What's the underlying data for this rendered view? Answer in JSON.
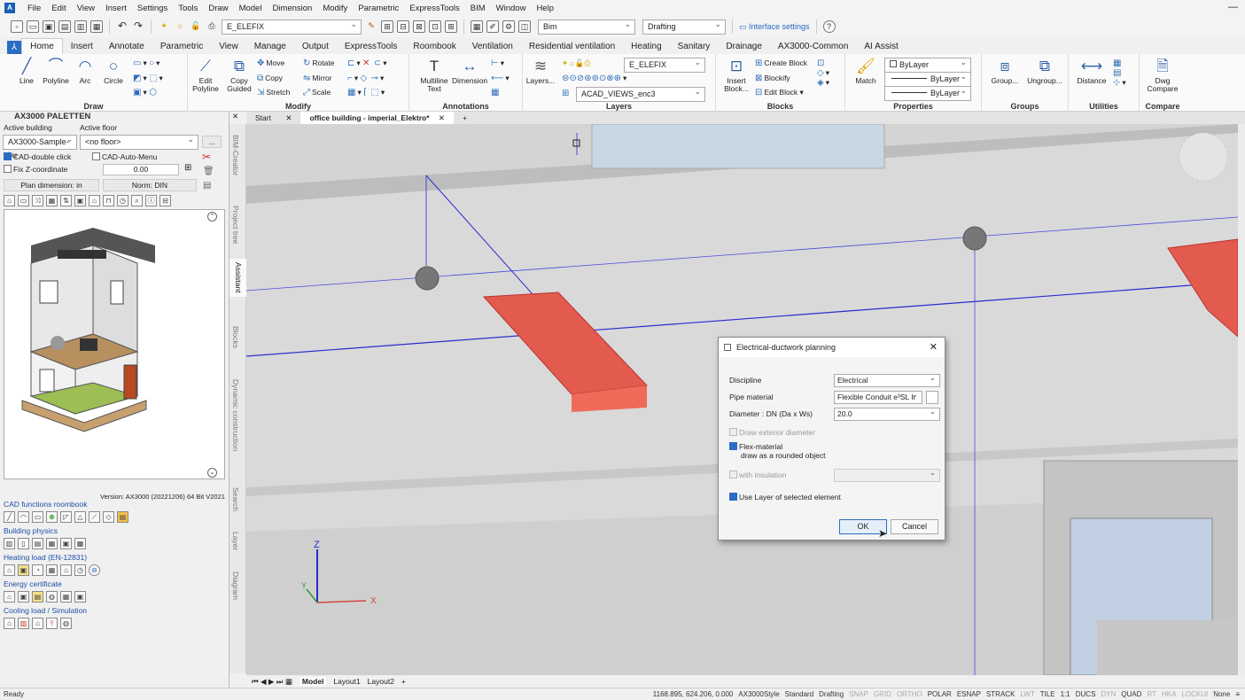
{
  "menu": [
    "File",
    "Edit",
    "View",
    "Insert",
    "Settings",
    "Tools",
    "Draw",
    "Model",
    "Dimension",
    "Modify",
    "Parametric",
    "ExpressTools",
    "BIM",
    "Window",
    "Help"
  ],
  "qat": {
    "layer_value": "E_ELEFIX",
    "workspace": "Bim",
    "style": "Drafting",
    "interface_label": "Interface settings"
  },
  "ribbon_tabs": [
    "Home",
    "Insert",
    "Annotate",
    "Parametric",
    "View",
    "Manage",
    "Output",
    "ExpressTools",
    "Roombook",
    "Ventilation",
    "Residential ventilation",
    "Heating",
    "Sanitary",
    "Drainage",
    "AX3000-Common",
    "AI Assist"
  ],
  "ribbon": {
    "draw": {
      "title": "Draw",
      "line": "Line",
      "polyline": "Polyline",
      "arc": "Arc",
      "circle": "Circle"
    },
    "modify": {
      "title": "Modify",
      "edit_polyline": "Edit Polyline",
      "copy_guided": "Copy Guided",
      "move": "Move",
      "rotate": "Rotate",
      "copy": "Copy",
      "mirror": "Mirror",
      "stretch": "Stretch",
      "scale": "Scale"
    },
    "annotations": {
      "title": "Annotations",
      "mtext": "Multiline Text",
      "dimension": "Dimension"
    },
    "layers": {
      "title": "Layers",
      "layers_btn": "Layers...",
      "layer1": "E_ELEFIX",
      "layer2": "ACAD_VIEWS_enc3"
    },
    "blocks": {
      "title": "Blocks",
      "insert": "Insert Block...",
      "create": "Create Block",
      "blockify": "Blockify",
      "edit": "Edit Block"
    },
    "properties": {
      "title": "Properties",
      "match": "Match",
      "bylayer1": "ByLayer",
      "bylayer2": "ByLayer",
      "bylayer3": "ByLayer"
    },
    "groups": {
      "title": "Groups",
      "group": "Group...",
      "ungroup": "Ungroup..."
    },
    "utilities": {
      "title": "Utilities",
      "distance": "Distance"
    },
    "compare": {
      "title": "Compare",
      "dwg": "Dwg Compare"
    }
  },
  "palette": {
    "title": "AX3000 PALETTEN",
    "active_building": "Active building",
    "active_floor": "Active floor",
    "building_value": "AX3000-Sample-bu",
    "floor_value": "<no floor>",
    "cad_double_click": "CAD-double click",
    "cad_auto_menu": "CAD-Auto-Menu",
    "fix_z": "Fix Z-coordinate",
    "z_value": "0.00",
    "plan_dimension": "Plan dimension: in",
    "norm": "Norm: DIN",
    "version": "Version: AX3000 (20221206) 64 Bit V2021",
    "sections": [
      "CAD functions roombook",
      "Building physics",
      "Heating load (EN-12831)",
      "Energy certificate",
      "Cooling load / Simulation"
    ]
  },
  "vtabs": [
    "BIM-Creator",
    "Project tree",
    "Assistant",
    "Blocks",
    "Dynamic construction",
    "Search",
    "Layer",
    "Diagram"
  ],
  "doc_tabs": [
    "Start",
    "office building - imperial_Elektro*"
  ],
  "layout_tabs": [
    "Model",
    "Layout1",
    "Layout2"
  ],
  "status": {
    "ready": "Ready",
    "coords": "1168.895, 624.206, 0.000",
    "items": [
      "AX3000Style",
      "Standard",
      "Drafting",
      "SNAP",
      "GRID",
      "ORTHO",
      "POLAR",
      "ESNAP",
      "STRACK",
      "LWT",
      "TILE",
      "1:1",
      "DUCS",
      "DYN",
      "QUAD",
      "RT",
      "HKA",
      "LOCKUI",
      "None"
    ]
  },
  "dialog": {
    "title": "Electrical-ductwork planning",
    "discipline_label": "Discipline",
    "discipline_value": "Electrical",
    "material_label": "Pipe material",
    "material_value": "Flexible Conduit e³SL Ir",
    "diameter_label": "Diameter : DN  (Da x Ws)",
    "diameter_value": "20.0",
    "exterior_label": "Draw exterior diameter",
    "flex_label": "Flex-material",
    "flex_sub": "draw as a rounded object",
    "insulation_label": "with insulation",
    "use_layer_label": "Use Layer of selected element",
    "ok": "OK",
    "cancel": "Cancel"
  },
  "colors": {
    "accent": "#2b6cc4",
    "duct": "#e25b4e"
  }
}
